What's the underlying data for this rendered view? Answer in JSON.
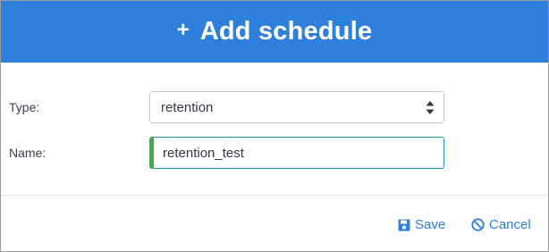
{
  "dialog": {
    "title": "Add schedule",
    "title_icon": "plus-icon",
    "accent_color": "#2f7fdd",
    "valid_color": "#3fae49"
  },
  "form": {
    "type_label": "Type:",
    "type_value": "retention",
    "name_label": "Name:",
    "name_value": "retention_test"
  },
  "footer": {
    "save_label": "Save",
    "save_icon": "floppy-disk-icon",
    "cancel_label": "Cancel",
    "cancel_icon": "ban-icon"
  }
}
